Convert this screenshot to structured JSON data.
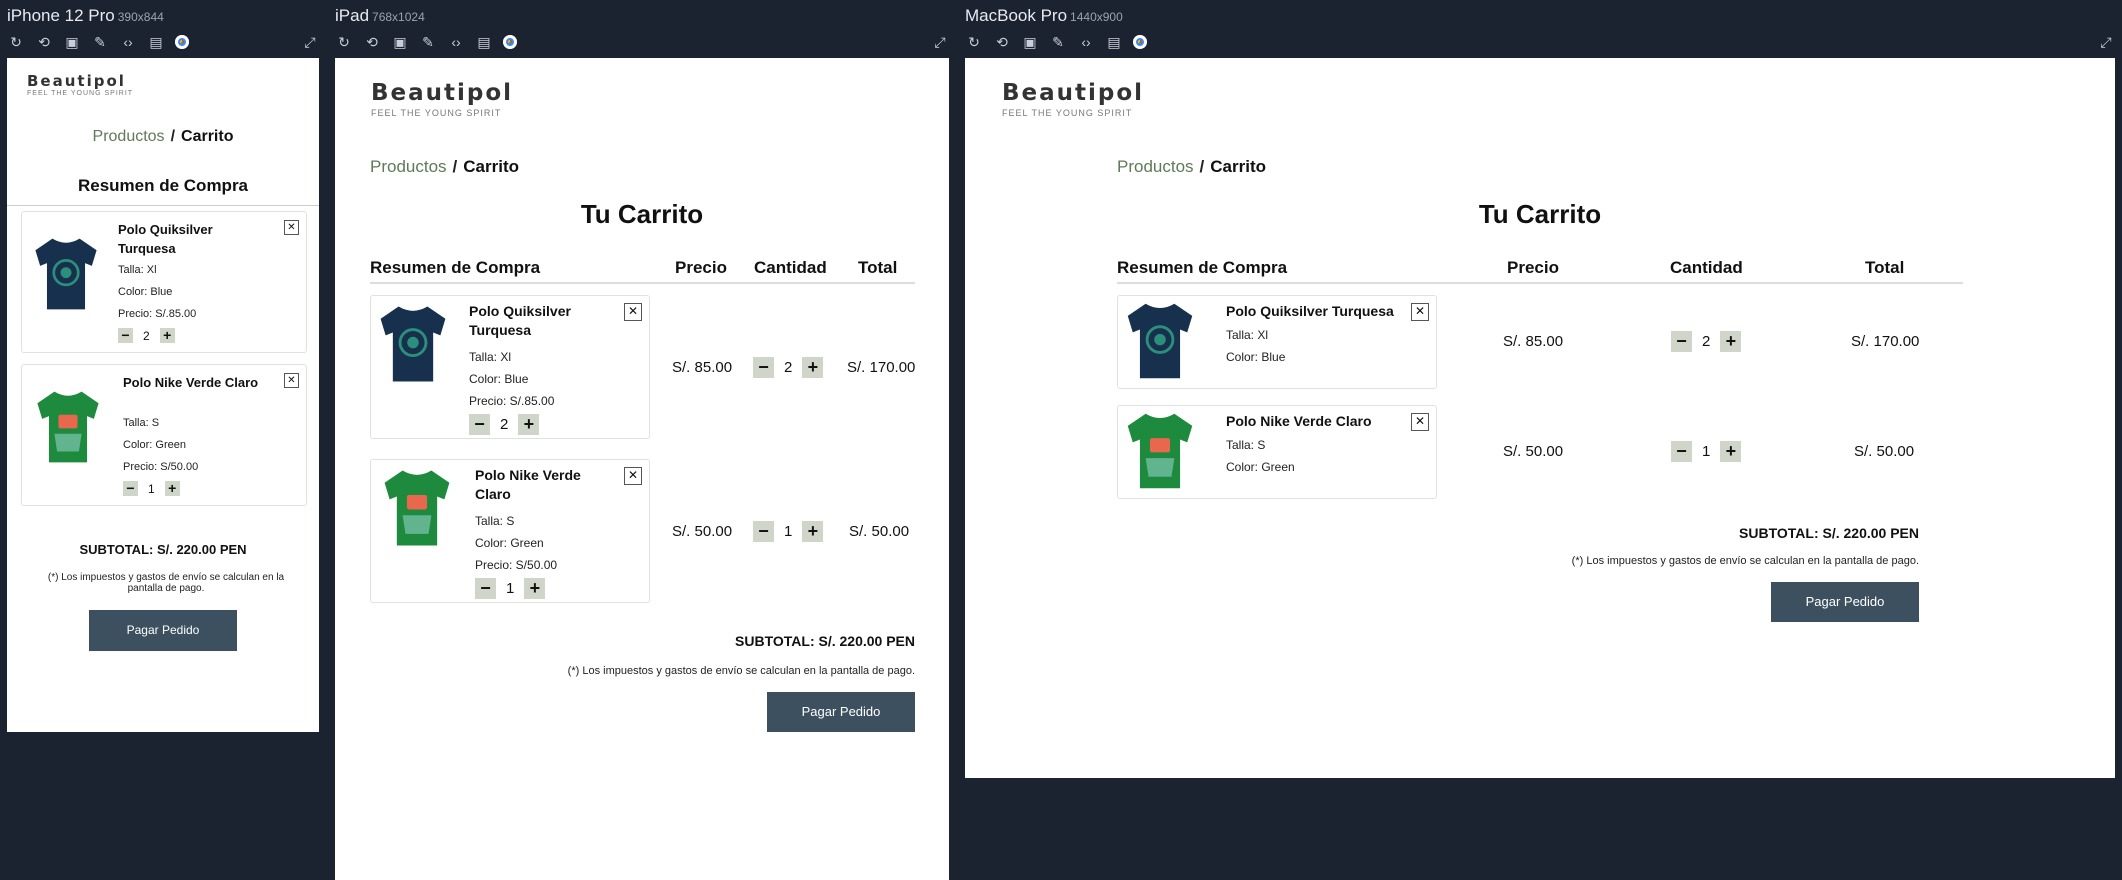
{
  "devices": {
    "iphone": {
      "name": "iPhone 12 Pro",
      "dims": "390x844"
    },
    "ipad": {
      "name": "iPad",
      "dims": "768x1024"
    },
    "macbook": {
      "name": "MacBook Pro",
      "dims": "1440x900"
    }
  },
  "toolbar_icons": [
    "refresh-icon",
    "camera-rotate-icon",
    "screenshot-icon",
    "eyedropper-icon",
    "code-icon",
    "layout-icon",
    "chrome-icon"
  ],
  "store": {
    "logo": "Beautipol",
    "tagline": "FEEL THE YOUNG SPIRIT",
    "breadcrumb": {
      "link": "Productos",
      "separator": "/",
      "current": "Carrito"
    },
    "cart_title": "Tu Carrito",
    "summary_title": "Resumen de Compra",
    "columns": {
      "price": "Precio",
      "quantity": "Cantidad",
      "total": "Total"
    },
    "items": [
      {
        "name": "Polo Quiksilver Turquesa",
        "size": "Talla: Xl",
        "color": "Color: Blue",
        "unit_price": "Precio: S/.85.00",
        "price": "S/. 85.00",
        "qty": "2",
        "total": "S/. 170.00",
        "shirt_color": "#17304d",
        "logo_color": "#2c8f7c"
      },
      {
        "name": "Polo Nike Verde Claro",
        "size": "Talla: S",
        "color": "Color: Green",
        "unit_price": "Precio: S/50.00",
        "price": "S/. 50.00",
        "qty": "1",
        "total": "S/. 50.00",
        "shirt_color": "#1d8a3d",
        "logo_color": "#e8674d"
      }
    ],
    "subtotal": "SUBTOTAL: S/. 220.00 PEN",
    "tax_note": "(*) Los impuestos y gastos de envío se calculan en la pantalla de pago.",
    "pay_button": "Pagar Pedido",
    "minus": "−",
    "plus": "+",
    "remove": "✕"
  }
}
